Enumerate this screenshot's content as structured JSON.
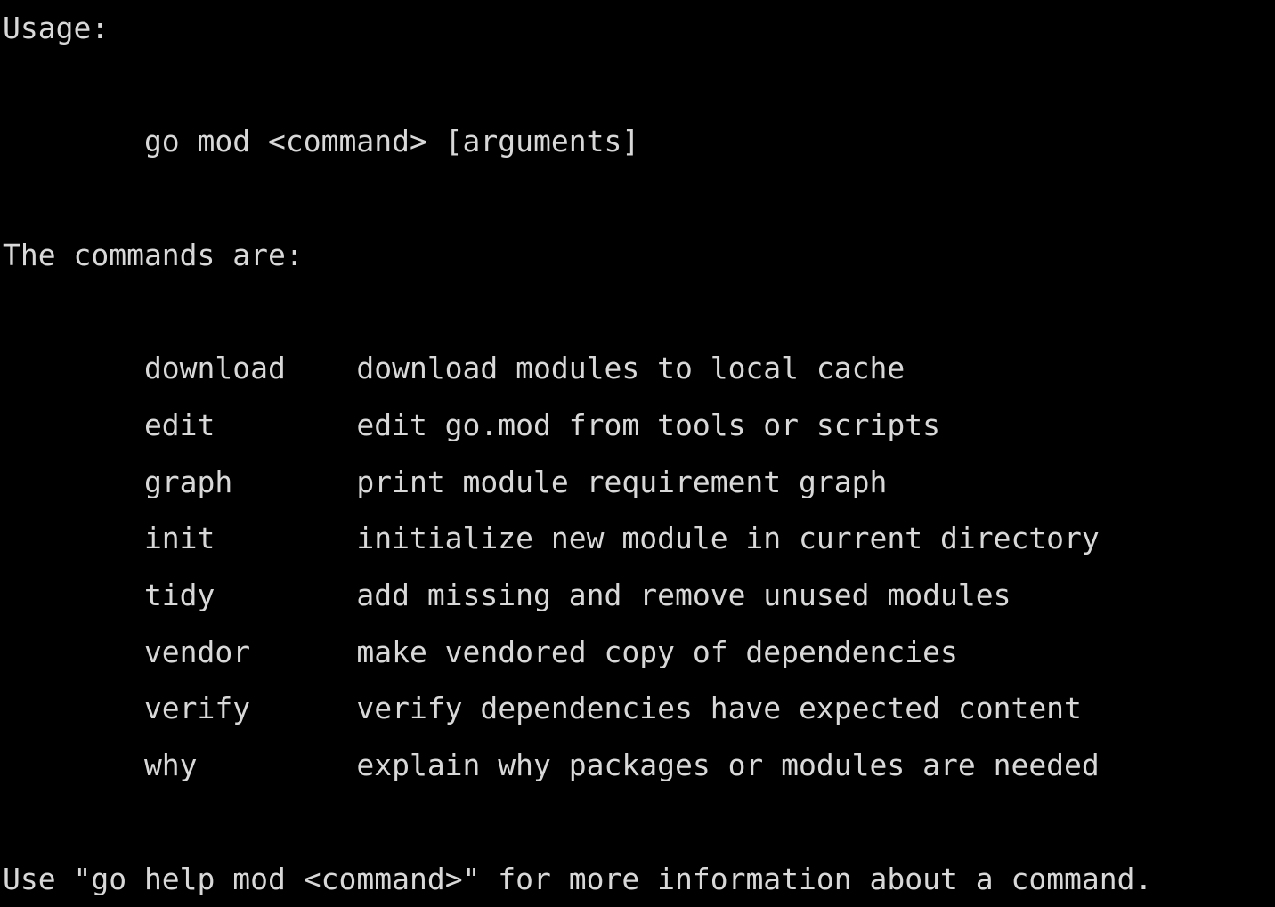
{
  "terminal": {
    "background_color": "#000000",
    "foreground_color": "#d8d8d8",
    "usage_heading": "Usage:",
    "usage_line": "\tgo mod <command> [arguments]",
    "usage_command": "go mod <command> [arguments]",
    "commands_heading": "The commands are:",
    "footer": "Use \"go help mod <command>\" for more information about a command.",
    "commands": [
      {
        "name": "download",
        "description": "download modules to local cache"
      },
      {
        "name": "edit",
        "description": "edit go.mod from tools or scripts"
      },
      {
        "name": "graph",
        "description": "print module requirement graph"
      },
      {
        "name": "init",
        "description": "initialize new module in current directory"
      },
      {
        "name": "tidy",
        "description": "add missing and remove unused modules"
      },
      {
        "name": "vendor",
        "description": "make vendored copy of dependencies"
      },
      {
        "name": "verify",
        "description": "verify dependencies have expected content"
      },
      {
        "name": "why",
        "description": "explain why packages or modules are needed"
      }
    ]
  }
}
